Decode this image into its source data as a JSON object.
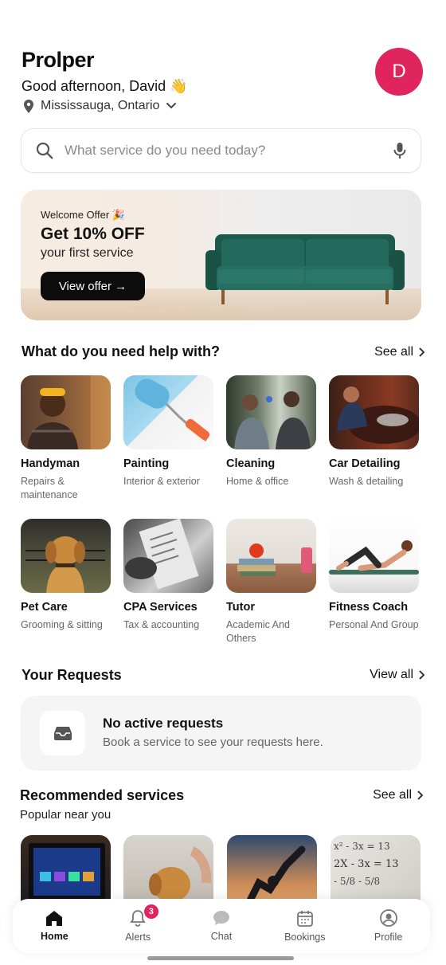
{
  "header": {
    "brand": "Prolper",
    "greeting": "Good afternoon, David 👋",
    "location": "Mississauga, Ontario",
    "avatar_initial": "D"
  },
  "search": {
    "placeholder": "What service do you need today?"
  },
  "banner": {
    "kicker": "Welcome Offer 🎉",
    "title": "Get 10% OFF",
    "subtitle": "your first service",
    "button": "View offer →"
  },
  "help": {
    "title": "What do you need help with?",
    "link": "See all",
    "categories": [
      {
        "name": "Handyman",
        "desc": "Repairs & maintenance"
      },
      {
        "name": "Painting",
        "desc": "Interior & exterior"
      },
      {
        "name": "Cleaning",
        "desc": "Home & office"
      },
      {
        "name": "Car Detailing",
        "desc": "Wash & detailing"
      },
      {
        "name": "Pet Care",
        "desc": "Grooming & sitting"
      },
      {
        "name": "CPA Services",
        "desc": "Tax & accounting"
      },
      {
        "name": "Tutor",
        "desc": "Academic And Others"
      },
      {
        "name": "Fitness Coach",
        "desc": "Personal And Group"
      }
    ]
  },
  "requests": {
    "title": "Your Requests",
    "link": "View all",
    "empty_title": "No active requests",
    "empty_sub": "Book a service to see your requests here."
  },
  "recommended": {
    "title": "Recommended services",
    "subtitle": "Popular near you",
    "link": "See all",
    "math_text": "x² - 3x = 13\n2X - 3x = 13\n- 5/8 - 5/8"
  },
  "tabbar": {
    "items": [
      {
        "label": "Home"
      },
      {
        "label": "Alerts"
      },
      {
        "label": "Chat"
      },
      {
        "label": "Bookings"
      },
      {
        "label": "Profile"
      }
    ],
    "alerts_badge": "3"
  },
  "colors": {
    "accent": "#e0245e",
    "dark": "#0c0c0c",
    "sofa": "#1f5a4f"
  }
}
